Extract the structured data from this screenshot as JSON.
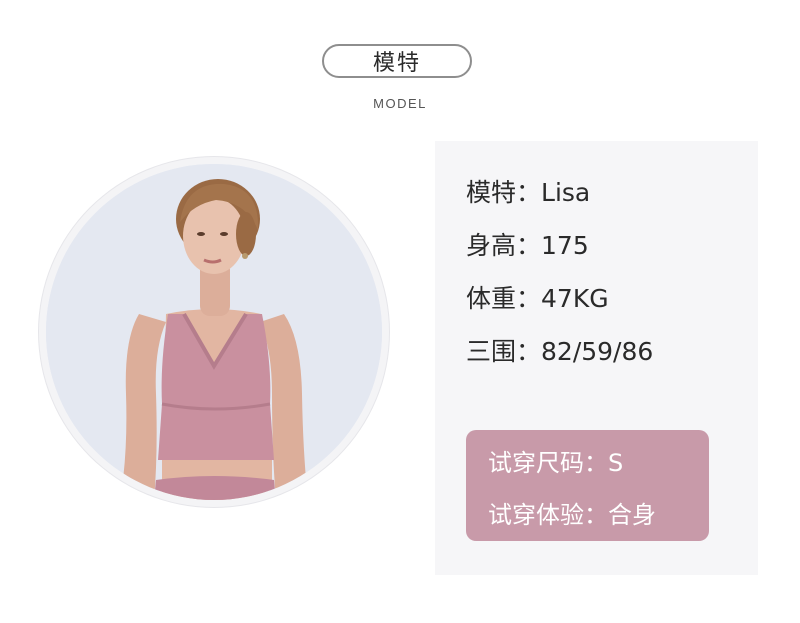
{
  "header": {
    "title": "模特",
    "subtitle": "MODEL"
  },
  "photo": {
    "subject": "model-photo"
  },
  "model_info": {
    "rows": [
      {
        "label": "模特：",
        "value": "Lisa"
      },
      {
        "label": "身高：",
        "value": "175"
      },
      {
        "label": "体重：",
        "value": "47KG"
      },
      {
        "label": "三围：",
        "value": "82/59/86"
      }
    ]
  },
  "fit_info": {
    "rows": [
      {
        "label": "试穿尺码：",
        "value": "S"
      },
      {
        "label": "试穿体验：",
        "value": "合身"
      }
    ]
  },
  "colors": {
    "panel_bg": "#f6f6f8",
    "fit_box_bg": "#c89aa9",
    "garment": "#c9909f"
  }
}
